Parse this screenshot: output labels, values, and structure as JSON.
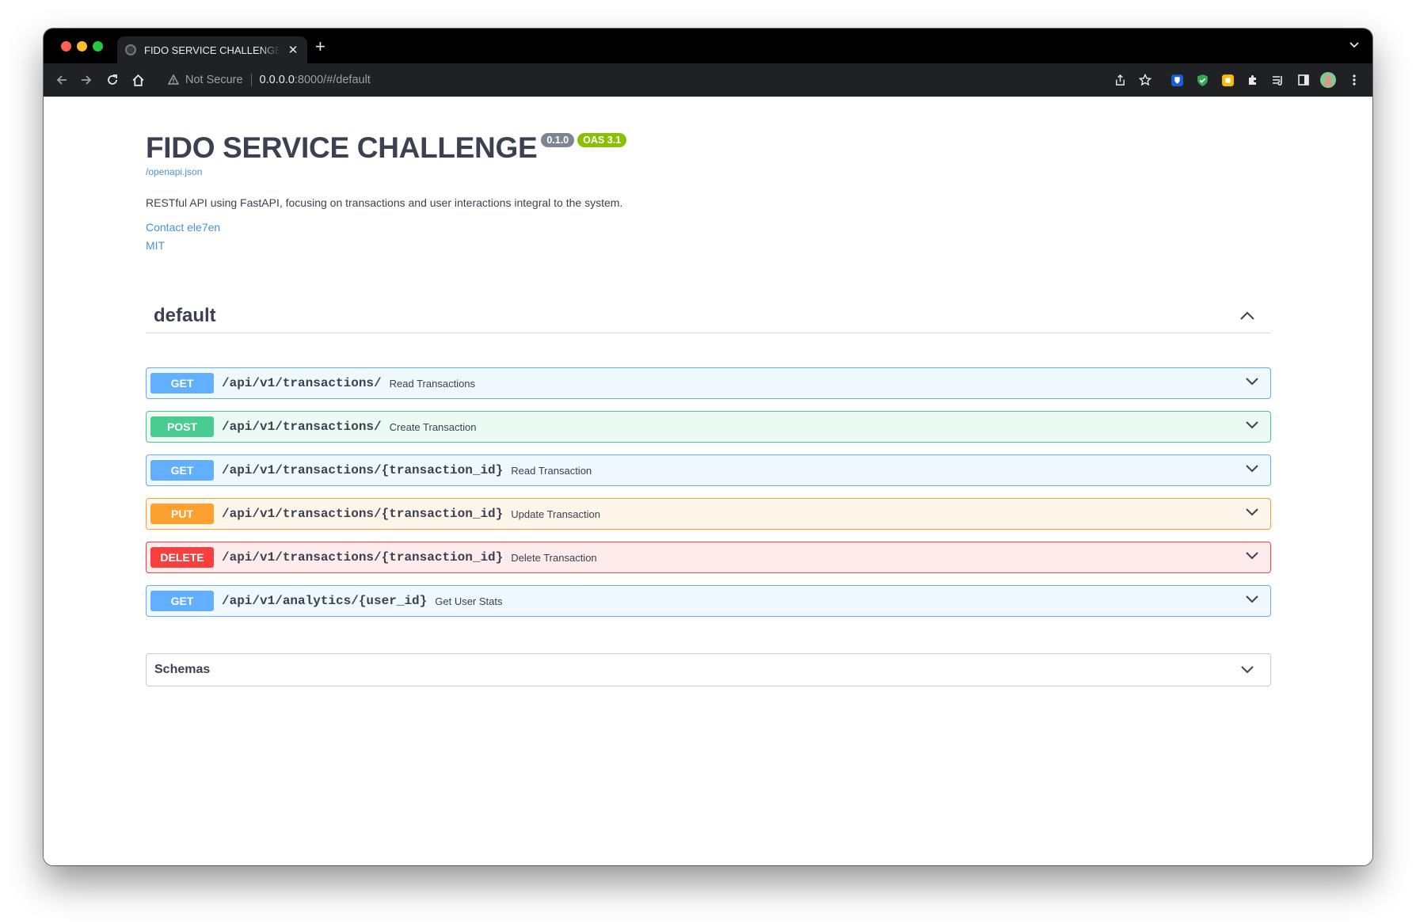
{
  "browser": {
    "tab_title": "FIDO SERVICE CHALLENGE - Swagger UI",
    "tab_close": "✕",
    "new_tab": "+",
    "security_label": "Not Secure",
    "url_host": "0.0.0.0",
    "url_rest": ":8000/#/default"
  },
  "info": {
    "title": "FIDO SERVICE CHALLENGE",
    "version": "0.1.0",
    "oas": "OAS 3.1",
    "spec_link": "/openapi.json",
    "description": "RESTful API using FastAPI, focusing on transactions and user interactions integral to the system.",
    "contact": "Contact ele7en",
    "license": "MIT"
  },
  "tag": {
    "name": "default"
  },
  "operations": [
    {
      "method": "GET",
      "path": "/api/v1/transactions/",
      "summary": "Read Transactions"
    },
    {
      "method": "POST",
      "path": "/api/v1/transactions/",
      "summary": "Create Transaction"
    },
    {
      "method": "GET",
      "path": "/api/v1/transactions/{transaction_id}",
      "summary": "Read Transaction"
    },
    {
      "method": "PUT",
      "path": "/api/v1/transactions/{transaction_id}",
      "summary": "Update Transaction"
    },
    {
      "method": "DELETE",
      "path": "/api/v1/transactions/{transaction_id}",
      "summary": "Delete Transaction"
    },
    {
      "method": "GET",
      "path": "/api/v1/analytics/{user_id}",
      "summary": "Get User Stats"
    }
  ],
  "schemas": {
    "title": "Schemas"
  },
  "colors": {
    "get": "#61affe",
    "post": "#49cc90",
    "put": "#fca130",
    "delete": "#f93e3e",
    "text": "#3b4151",
    "link": "#4990e2"
  }
}
